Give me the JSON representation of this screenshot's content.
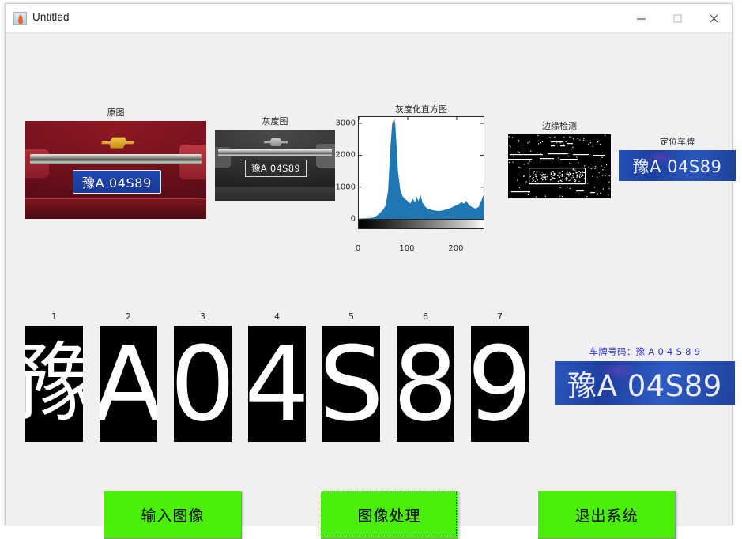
{
  "window": {
    "title": "Untitled",
    "icon": "matlab-icon",
    "controls": {
      "minimize": "minimize-icon",
      "maximize": "maximize-icon",
      "close": "close-icon"
    }
  },
  "panels": {
    "original": {
      "title": "原图",
      "plate_text": "豫A 04S89"
    },
    "gray": {
      "title": "灰度图",
      "plate_text": "豫A 04S89"
    },
    "edge": {
      "title": "边缘检测"
    },
    "located": {
      "title": "定位车牌",
      "plate_text": "豫A 04S89"
    }
  },
  "chart_data": {
    "type": "bar",
    "title": "灰度化直方图",
    "xlabel": "",
    "ylabel": "",
    "xlim": [
      0,
      255
    ],
    "ylim": [
      0,
      3200
    ],
    "grid": false,
    "legend": null,
    "bar_color": "#1f77b4",
    "colorbar": "grayscale-ramp",
    "xticks": [
      0,
      100,
      200
    ],
    "xticklabels": [
      "0",
      "100",
      "200"
    ],
    "yticks": [
      0,
      1000,
      2000,
      3000
    ],
    "yticklabels": [
      "0",
      "1000",
      "2000",
      "3000"
    ],
    "x": [
      0,
      5,
      10,
      15,
      20,
      25,
      30,
      35,
      40,
      45,
      50,
      55,
      60,
      62,
      65,
      68,
      70,
      72,
      74,
      76,
      78,
      80,
      85,
      90,
      95,
      100,
      105,
      110,
      115,
      118,
      122,
      126,
      130,
      135,
      140,
      145,
      150,
      155,
      160,
      165,
      170,
      175,
      180,
      185,
      190,
      195,
      200,
      205,
      210,
      215,
      220,
      225,
      230,
      235,
      240,
      245,
      250,
      255
    ],
    "values": [
      10,
      12,
      15,
      18,
      22,
      30,
      45,
      80,
      140,
      210,
      300,
      420,
      900,
      1500,
      2300,
      2950,
      3120,
      2850,
      3180,
      2600,
      2100,
      1500,
      900,
      700,
      620,
      560,
      480,
      640,
      520,
      700,
      560,
      760,
      520,
      400,
      330,
      300,
      280,
      260,
      255,
      250,
      260,
      280,
      300,
      330,
      360,
      400,
      430,
      470,
      520,
      480,
      560,
      440,
      380,
      340,
      330,
      380,
      560,
      760
    ]
  },
  "characters": {
    "header_note": "segmented-characters",
    "items": [
      {
        "index": "1",
        "glyph": "豫",
        "cjk": true
      },
      {
        "index": "2",
        "glyph": "A",
        "cjk": false
      },
      {
        "index": "3",
        "glyph": "0",
        "cjk": false
      },
      {
        "index": "4",
        "glyph": "4",
        "cjk": false
      },
      {
        "index": "5",
        "glyph": "S",
        "cjk": false
      },
      {
        "index": "6",
        "glyph": "8",
        "cjk": false
      },
      {
        "index": "7",
        "glyph": "9",
        "cjk": false
      }
    ]
  },
  "result": {
    "label": "车牌号码：豫 A 0 4 S 8 9",
    "plate_text": "豫A 04S89",
    "label_color": "#2b33c8"
  },
  "buttons": {
    "input_image": "输入图像",
    "process_image": "图像处理",
    "exit_system": "退出系统",
    "color": "#4aee06",
    "focused": "process_image"
  }
}
